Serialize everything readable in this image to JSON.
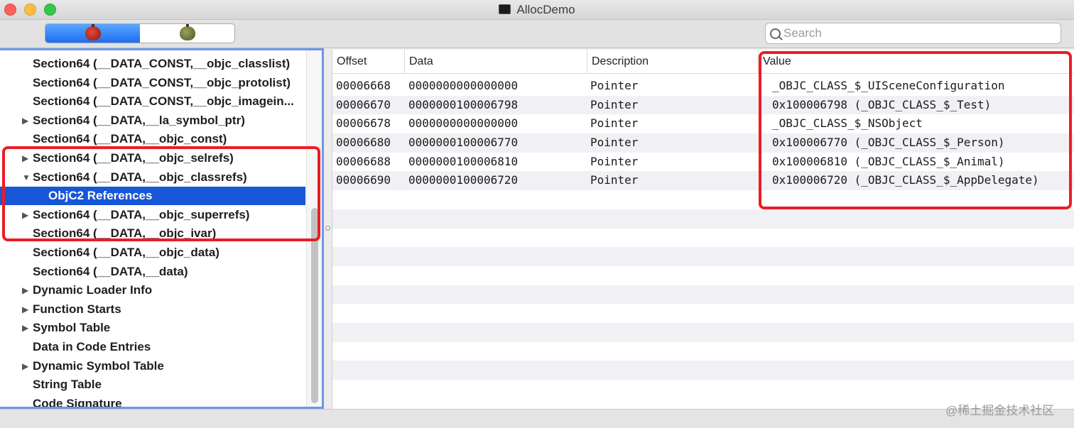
{
  "window": {
    "title": "AllocDemo"
  },
  "toolbar": {
    "segments": [
      {
        "icon": "red-apple-icon",
        "active": true
      },
      {
        "icon": "green-apple-icon",
        "active": false
      }
    ],
    "search": {
      "placeholder": "Search",
      "value": ""
    }
  },
  "sidebar": {
    "items": [
      {
        "label": "Section64 (__DATA_CONST,__objc_classlist)",
        "indent": 1,
        "disclosure": ""
      },
      {
        "label": "Section64 (__DATA_CONST,__objc_protolist)",
        "indent": 1,
        "disclosure": ""
      },
      {
        "label": "Section64 (__DATA_CONST,__objc_imagein...",
        "indent": 1,
        "disclosure": ""
      },
      {
        "label": "Section64 (__DATA,__la_symbol_ptr)",
        "indent": 1,
        "disclosure": "▶"
      },
      {
        "label": "Section64 (__DATA,__objc_const)",
        "indent": 1,
        "disclosure": ""
      },
      {
        "label": "Section64 (__DATA,__objc_selrefs)",
        "indent": 1,
        "disclosure": "▶"
      },
      {
        "label": "Section64 (__DATA,__objc_classrefs)",
        "indent": 1,
        "disclosure": "▼"
      },
      {
        "label": "ObjC2 References",
        "indent": 2,
        "disclosure": "",
        "selected": true
      },
      {
        "label": "Section64 (__DATA,__objc_superrefs)",
        "indent": 1,
        "disclosure": "▶"
      },
      {
        "label": "Section64 (__DATA,__objc_ivar)",
        "indent": 1,
        "disclosure": ""
      },
      {
        "label": "Section64 (__DATA,__objc_data)",
        "indent": 1,
        "disclosure": ""
      },
      {
        "label": "Section64 (__DATA,__data)",
        "indent": 1,
        "disclosure": ""
      },
      {
        "label": "Dynamic Loader Info",
        "indent": 1,
        "disclosure": "▶"
      },
      {
        "label": "Function Starts",
        "indent": 1,
        "disclosure": "▶"
      },
      {
        "label": "Symbol Table",
        "indent": 1,
        "disclosure": "▶"
      },
      {
        "label": "Data in Code Entries",
        "indent": 1,
        "disclosure": ""
      },
      {
        "label": "Dynamic Symbol Table",
        "indent": 1,
        "disclosure": "▶"
      },
      {
        "label": "String Table",
        "indent": 1,
        "disclosure": ""
      },
      {
        "label": "Code Signature",
        "indent": 1,
        "disclosure": ""
      }
    ]
  },
  "table": {
    "columns": [
      "Offset",
      "Data",
      "Description",
      "Value"
    ],
    "rows": [
      [
        "00006668",
        "0000000000000000",
        "Pointer",
        "_OBJC_CLASS_$_UISceneConfiguration"
      ],
      [
        "00006670",
        "0000000100006798",
        "Pointer",
        "0x100006798 (_OBJC_CLASS_$_Test)"
      ],
      [
        "00006678",
        "0000000000000000",
        "Pointer",
        "_OBJC_CLASS_$_NSObject"
      ],
      [
        "00006680",
        "0000000100006770",
        "Pointer",
        "0x100006770 (_OBJC_CLASS_$_Person)"
      ],
      [
        "00006688",
        "0000000100006810",
        "Pointer",
        "0x100006810 (_OBJC_CLASS_$_Animal)"
      ],
      [
        "00006690",
        "0000000100006720",
        "Pointer",
        "0x100006720 (_OBJC_CLASS_$_AppDelegate)"
      ]
    ],
    "empty_rows": 11
  },
  "annotations": {
    "highlight_color": "#ec1c24"
  },
  "watermark": "@稀土掘金技术社区"
}
